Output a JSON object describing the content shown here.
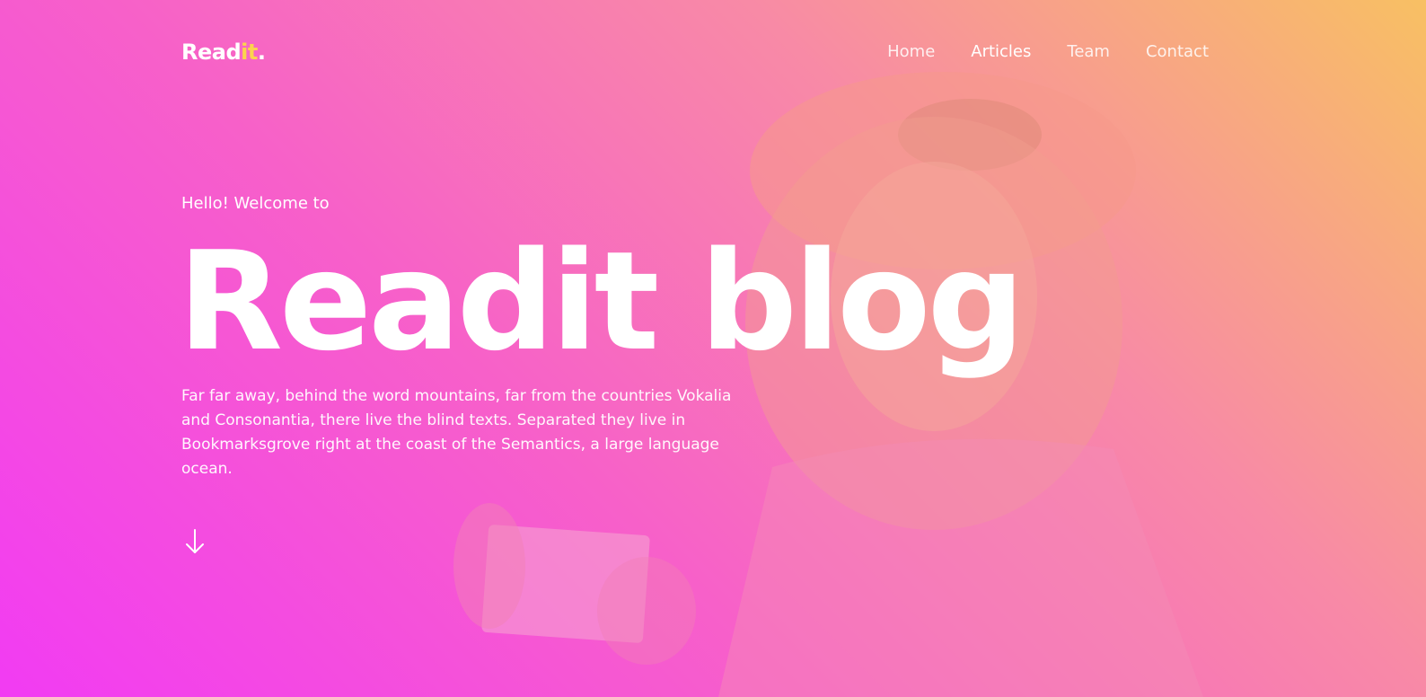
{
  "brand": {
    "name_main": "Read",
    "name_accent": "it",
    "name_dot": ".",
    "accent_color": "#fcd34d"
  },
  "nav": {
    "items": [
      {
        "label": "Home"
      },
      {
        "label": "Articles",
        "active": true
      },
      {
        "label": "Team"
      },
      {
        "label": "Contact"
      }
    ]
  },
  "hero": {
    "kicker": "Hello! Welcome to",
    "title": "Readit blog",
    "description": "Far far away, behind the word mountains, far from the countries Vokalia and Consonantia, there live the blind texts. Separated they live in Bookmarksgrove right at the coast of the Semantics, a large language ocean.",
    "scroll_icon": "arrow-down-icon",
    "gradient_colors": [
      "#f23bf3",
      "#f760c9",
      "#f88aa6",
      "#f8c063"
    ]
  }
}
